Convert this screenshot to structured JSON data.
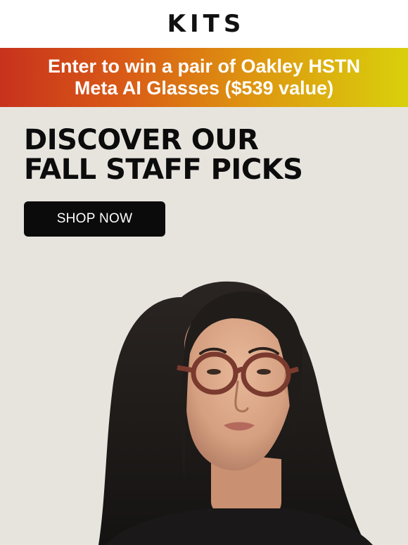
{
  "header": {
    "logo": "KITS"
  },
  "promo_banner": {
    "line1": "Enter to win a pair of Oakley HSTN",
    "line2": "Meta AI Glasses ($539 value)",
    "gradient": [
      "#c8321d",
      "#de9610",
      "#d9d00c"
    ]
  },
  "hero": {
    "headline_line1": "DISCOVER OUR",
    "headline_line2": "FALL STAFF PICKS",
    "cta_label": "SHOP NOW",
    "background": "#e7e4de",
    "image": "woman-with-round-brown-eyeglasses"
  }
}
